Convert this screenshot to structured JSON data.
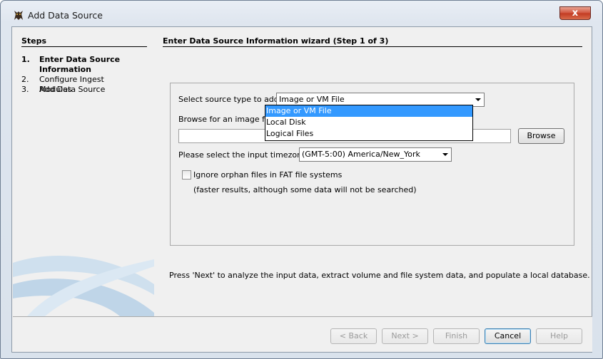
{
  "window": {
    "title": "Add Data Source",
    "close_label": "x",
    "app_icon": "autopsy-dog-icon"
  },
  "steps": {
    "title": "Steps",
    "items": [
      {
        "num": "1.",
        "label": "Enter Data Source Information",
        "current": true
      },
      {
        "num": "2.",
        "label": "Configure Ingest Modules",
        "current": false
      },
      {
        "num": "3.",
        "label": "Add Data Source",
        "current": false
      }
    ]
  },
  "wizard": {
    "title": "Enter Data Source Information wizard (Step 1 of 3)",
    "source_type_label": "Select source type to add:",
    "source_type_value": "Image or VM File",
    "source_type_options": [
      "Image or VM File",
      "Local Disk",
      "Logical Files"
    ],
    "browse_label": "Browse for an image file:",
    "image_path_value": "",
    "browse_button": "Browse",
    "timezone_label": "Please select the input timezone:",
    "timezone_value": "(GMT-5:00) America/New_York",
    "orphan_label": "Ignore orphan files in FAT file systems",
    "orphan_checked": false,
    "orphan_note": "(faster results, although some data will not be searched)",
    "next_hint": "Press 'Next' to analyze the input data, extract volume and file system data, and populate a local database."
  },
  "buttons": {
    "back": "< Back",
    "next": "Next >",
    "finish": "Finish",
    "cancel": "Cancel",
    "help": "Help"
  },
  "colors": {
    "selection": "#3399ff",
    "close_button": "#c23a22",
    "swoosh": "#b9d3e8"
  }
}
